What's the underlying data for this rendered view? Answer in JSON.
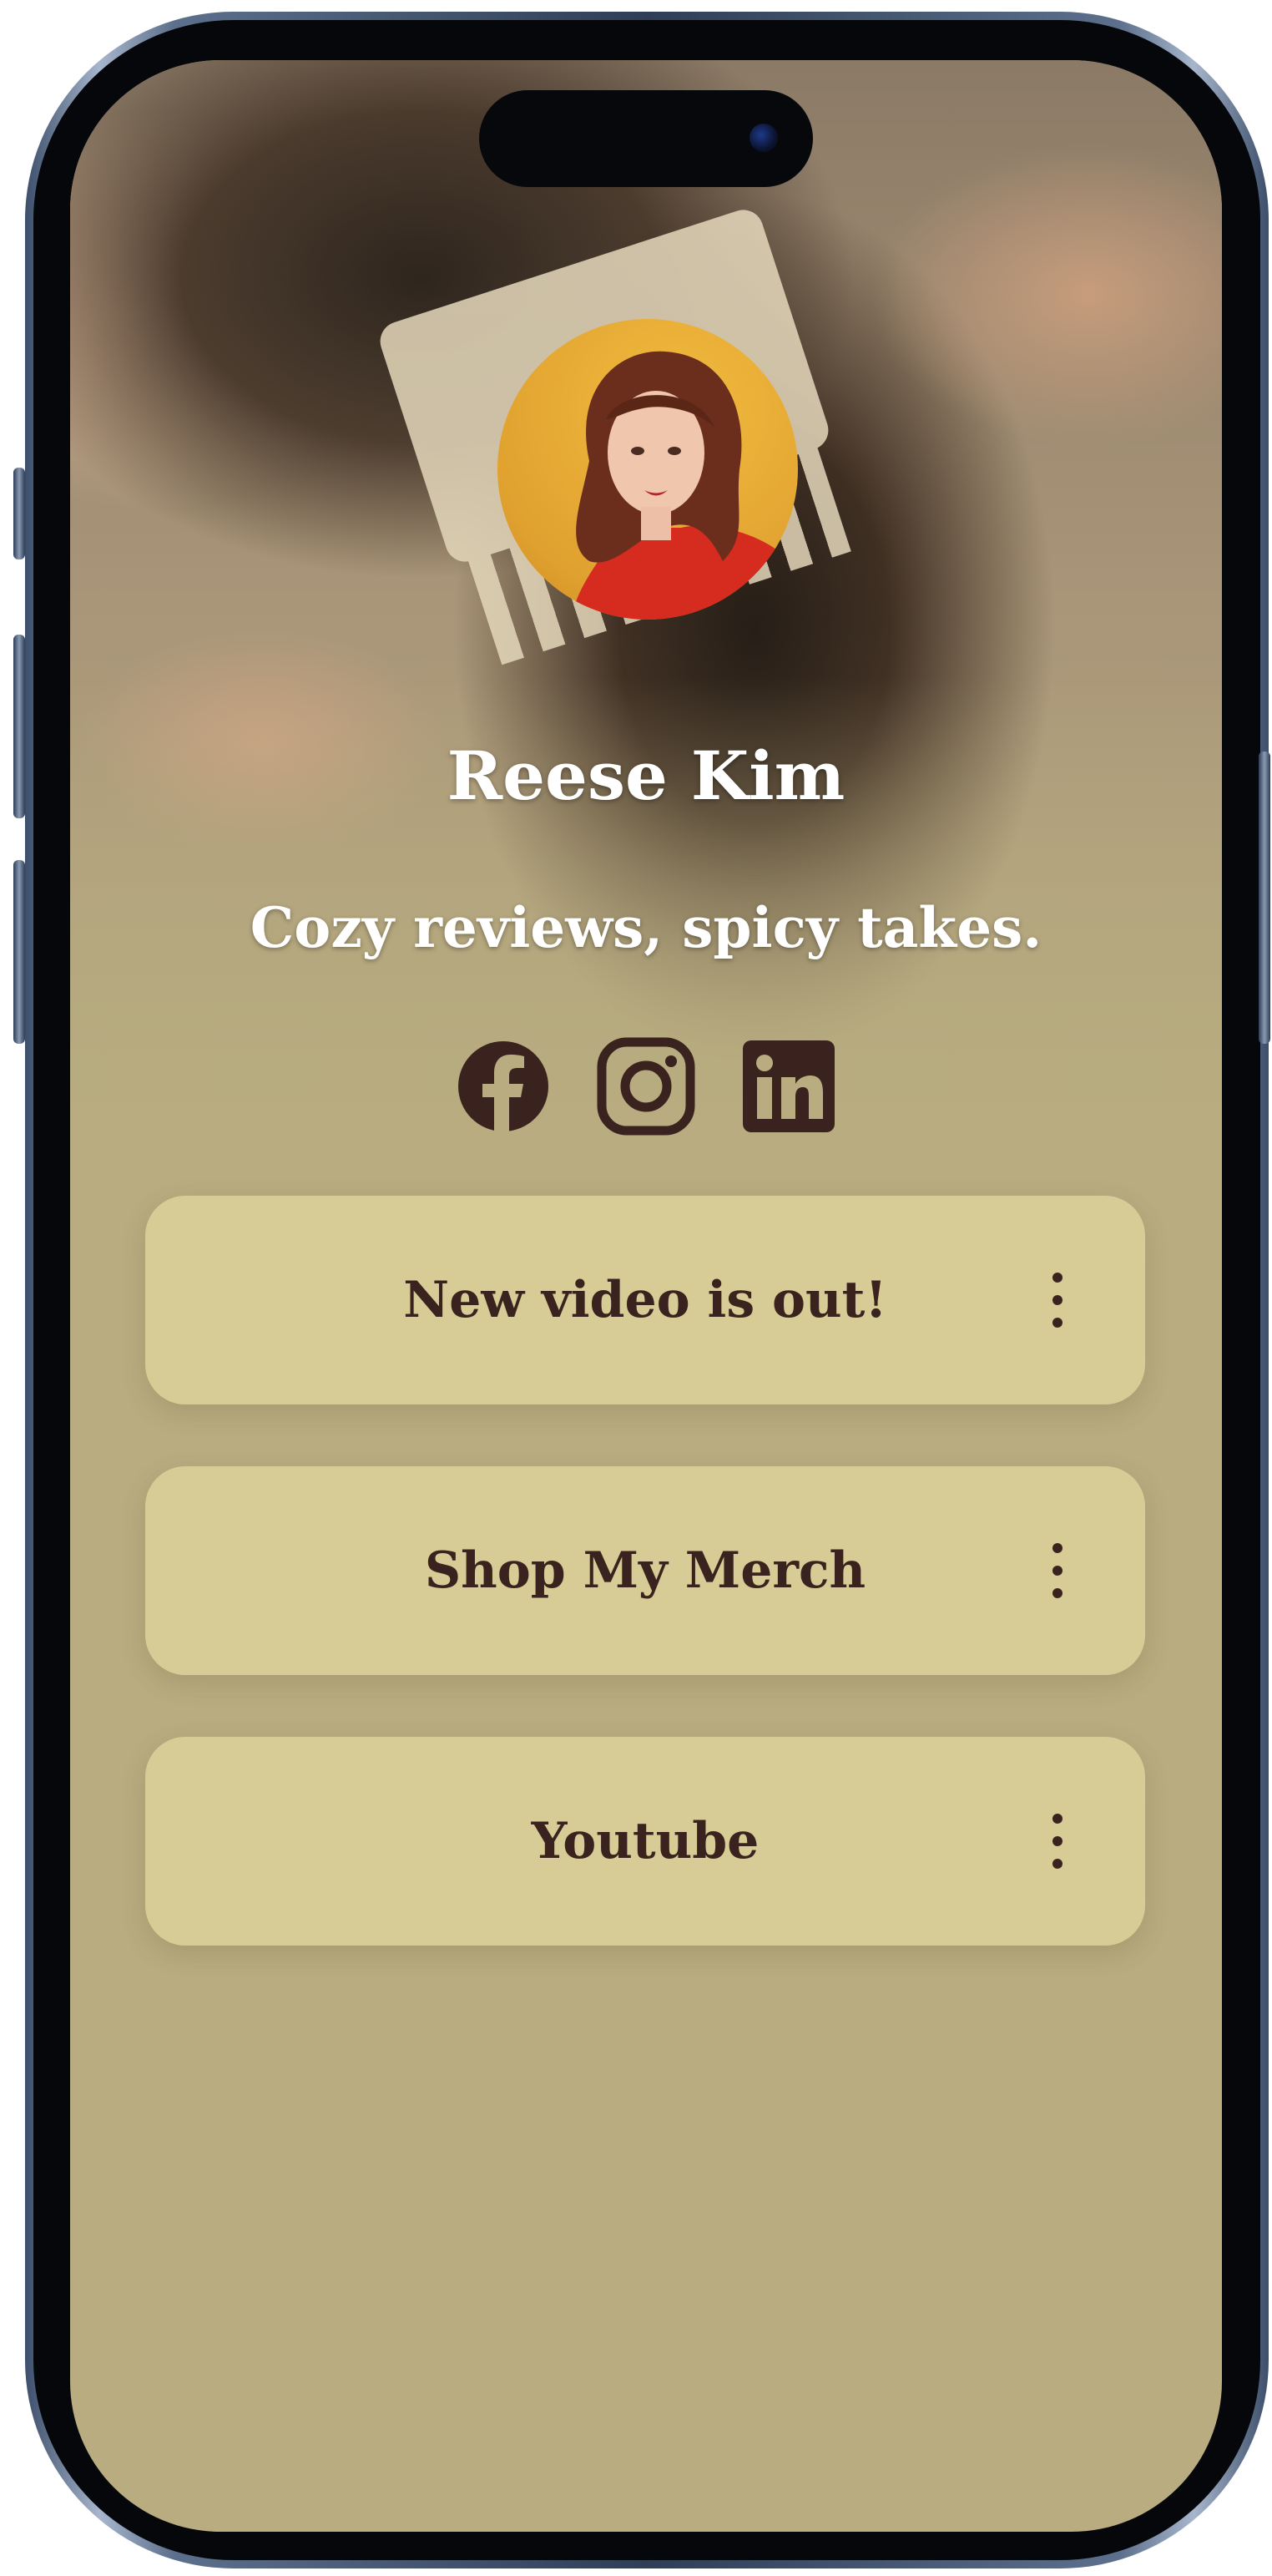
{
  "profile": {
    "name": "Reese Kim",
    "tagline": "Cozy reviews, spicy takes."
  },
  "social_icons": [
    {
      "icon": "facebook-icon"
    },
    {
      "icon": "instagram-icon"
    },
    {
      "icon": "linkedin-icon"
    }
  ],
  "links": [
    {
      "label": "New video is out!",
      "menu_icon": "more-vertical-icon"
    },
    {
      "label": "Shop My Merch",
      "menu_icon": "more-vertical-icon"
    },
    {
      "label": "Youtube",
      "menu_icon": "more-vertical-icon"
    }
  ],
  "colors": {
    "background": "#b8ac80",
    "button_fill": "#d8cc96",
    "button_text": "#3a231e",
    "icon_color": "#3a231e",
    "heading_text": "#ffffff",
    "phone_frame": "#2f3e56"
  }
}
